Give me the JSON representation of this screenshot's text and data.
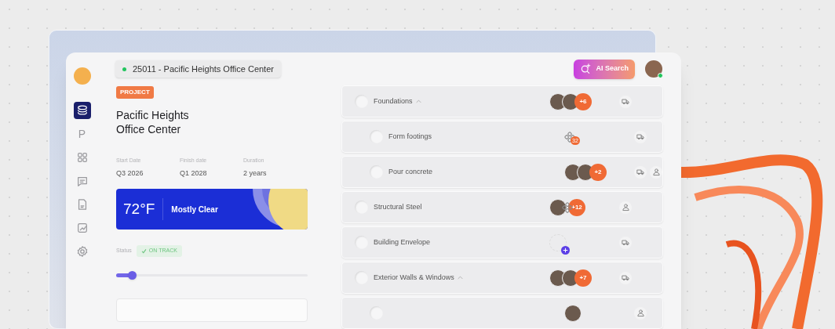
{
  "sidebar": {
    "items": [
      {
        "kind": "layers",
        "selected": true
      },
      {
        "kind": "text",
        "label": "P",
        "selected": false
      },
      {
        "kind": "grid",
        "selected": false
      },
      {
        "kind": "chat",
        "selected": false
      },
      {
        "kind": "document",
        "selected": false
      },
      {
        "kind": "chart",
        "selected": false
      },
      {
        "kind": "settings",
        "selected": false
      }
    ]
  },
  "project_selector": {
    "label": "25011 - Pacific Heights Office Center",
    "color": "#22c55e"
  },
  "ai_search": {
    "label": "AI Search"
  },
  "user": {
    "online": true
  },
  "project": {
    "tag": "PROJECT",
    "title": "Pacific Heights Office Center",
    "details": [
      {
        "label": "Start Date",
        "value": "Q3 2026"
      },
      {
        "label": "Finish date",
        "value": "Q1 2028"
      },
      {
        "label": "Duration",
        "value": "2 years"
      }
    ],
    "weather": {
      "temperature": "72°F",
      "condition": "Mostly Clear"
    },
    "status": {
      "label": "Status",
      "value": "ON TRACK"
    },
    "progress": {
      "level": 0.08
    }
  },
  "tasks": [
    {
      "name": "Foundations",
      "done": false,
      "expanded": true,
      "assignees": [
        {
          "kind": "person"
        },
        {
          "kind": "person"
        }
      ],
      "more": "+6",
      "resources": [
        {
          "kind": "truck"
        }
      ],
      "children": [
        {
          "name": "Form footings",
          "done": false,
          "assignees": [
            {
              "kind": "crew",
              "badge": "32"
            }
          ],
          "resources": [
            {
              "kind": "truck"
            }
          ]
        },
        {
          "name": "Pour concrete",
          "done": false,
          "assignees": [
            {
              "kind": "person"
            },
            {
              "kind": "person"
            }
          ],
          "more": "+2",
          "resources": [
            {
              "kind": "truck"
            },
            {
              "kind": "worker"
            }
          ]
        }
      ]
    },
    {
      "name": "Structural Steel",
      "done": false,
      "assignees": [
        {
          "kind": "person"
        },
        {
          "kind": "crew"
        }
      ],
      "more": "+12",
      "resources": [
        {
          "kind": "worker"
        }
      ]
    },
    {
      "name": "Building Envelope",
      "done": false,
      "assignees": [
        {
          "kind": "add"
        }
      ],
      "resources": [
        {
          "kind": "truck"
        }
      ]
    },
    {
      "name": "Exterior Walls & Windows",
      "done": false,
      "expanded": true,
      "assignees": [
        {
          "kind": "person"
        },
        {
          "kind": "person"
        }
      ],
      "more": "+7",
      "resources": [
        {
          "kind": "truck"
        }
      ],
      "children": [
        {
          "done": false,
          "assignees": [
            {
              "kind": "person"
            }
          ],
          "resources": [
            {
              "kind": "worker"
            }
          ]
        }
      ]
    }
  ]
}
